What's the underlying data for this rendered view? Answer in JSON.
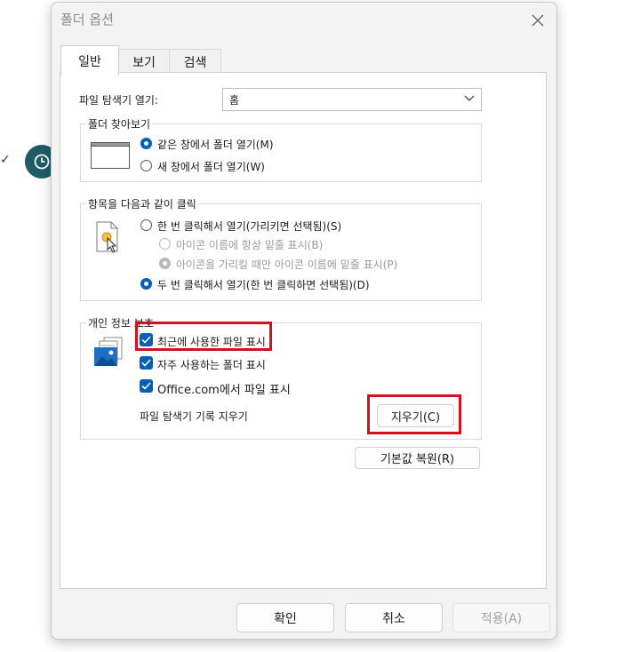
{
  "dialog": {
    "title": "폴더 옵션",
    "close_icon": "close-icon",
    "tabs": [
      {
        "label": "일반",
        "active": true
      },
      {
        "label": "보기",
        "active": false
      },
      {
        "label": "검색",
        "active": false
      }
    ]
  },
  "general": {
    "open_explorer_label": "파일 탐색기 열기:",
    "open_explorer_value": "홈",
    "browse_folders": {
      "legend": "폴더 찾아보기",
      "options": [
        {
          "label": "같은 창에서 폴더 열기(M)",
          "selected": true
        },
        {
          "label": "새 창에서 폴더 열기(W)",
          "selected": false
        }
      ]
    },
    "click_items": {
      "legend": "항목을 다음과 같이 클릭",
      "single_click": "한 번 클릭해서 열기(가리키면 선택됨)(S)",
      "underline_always": "아이콘 이름에 항상 밑줄 표시(B)",
      "underline_hover": "아이콘을 가리킬 때만 아이콘 이름에 밑줄 표시(P)",
      "double_click": "두 번 클릭해서 열기(한 번 클릭하면 선택됨)(D)"
    },
    "privacy": {
      "legend": "개인 정보 보호",
      "checkboxes": [
        {
          "label": "최근에 사용한 파일 표시",
          "checked": true
        },
        {
          "label": "자주 사용하는 폴더 표시",
          "checked": true
        },
        {
          "label": "Office.com에서 파일 표시",
          "checked": true
        }
      ],
      "clear_history_label": "파일 탐색기 기록 지우기",
      "clear_button": "지우기(C)"
    },
    "restore_defaults_button": "기본값 복원(R)"
  },
  "footer": {
    "ok": "확인",
    "cancel": "취소",
    "apply": "적용(A)"
  },
  "colors": {
    "accent": "#005fb8",
    "highlight": "#d0141f",
    "clock_badge": "#1f5d66"
  }
}
